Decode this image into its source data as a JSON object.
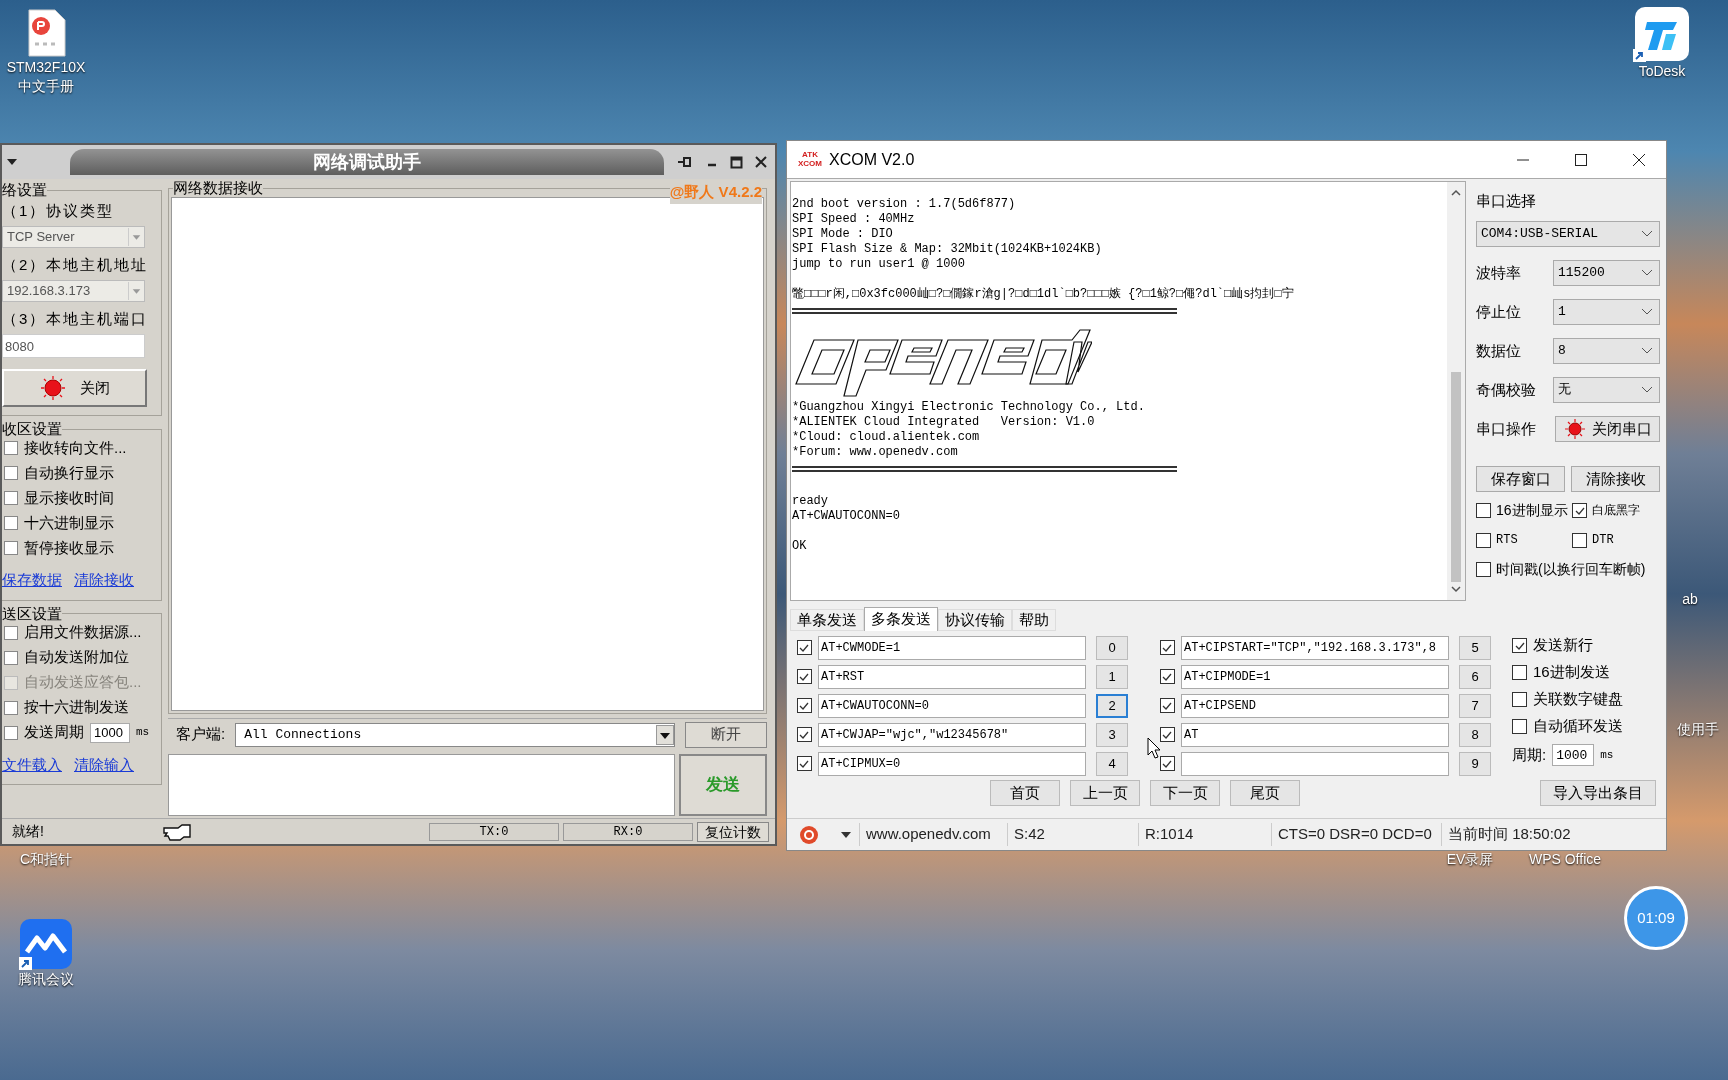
{
  "desktop_icons": [
    {
      "kind": "pdf",
      "label_lines": [
        "STM32F10X",
        "中文手册"
      ],
      "shortcut": false
    },
    {
      "kind": "todesk",
      "label_lines": [
        "ToDesk"
      ],
      "shortcut": true
    },
    {
      "kind": "label_only",
      "label_lines": [
        "C和指针"
      ],
      "shortcut": false
    },
    {
      "kind": "meeting",
      "label_lines": [
        "腾讯会议"
      ],
      "shortcut": true
    },
    {
      "kind": "label_only",
      "label_lines": [
        "EV录屏"
      ],
      "shortcut": false
    },
    {
      "kind": "label_only",
      "label_lines": [
        "WPS Office"
      ],
      "shortcut": false
    },
    {
      "kind": "label_only",
      "label_lines": [
        "ab"
      ],
      "shortcut": false
    },
    {
      "kind": "label_only",
      "label_lines": [
        "使用手"
      ],
      "shortcut": false
    }
  ],
  "timer": {
    "text": "01:09"
  },
  "net_assistant": {
    "title": "网络调试助手",
    "version": "@野人 V4.2.2",
    "net_settings": {
      "title": "络设置",
      "fields": [
        {
          "label": "（1）协议类型",
          "kind": "select",
          "value": "TCP Server",
          "disabled": true
        },
        {
          "label": "（2）本地主机地址",
          "kind": "select",
          "value": "192.168.3.173",
          "disabled": true
        },
        {
          "label": "（3）本地主机端口",
          "kind": "input",
          "value": "8080",
          "disabled": true
        }
      ],
      "button": "关闭"
    },
    "receive_settings": {
      "title": "收区设置",
      "options": [
        {
          "label": "接收转向文件...",
          "checked": false
        },
        {
          "label": "自动换行显示",
          "checked": false
        },
        {
          "label": "显示接收时间",
          "checked": false
        },
        {
          "label": "十六进制显示",
          "checked": false
        },
        {
          "label": "暂停接收显示",
          "checked": false
        }
      ],
      "links": [
        "保存数据",
        "清除接收"
      ]
    },
    "send_settings": {
      "title": "送区设置",
      "options": [
        {
          "kind": "check",
          "label": "启用文件数据源...",
          "checked": false,
          "disabled": false
        },
        {
          "kind": "check",
          "label": "自动发送附加位",
          "checked": false,
          "disabled": false
        },
        {
          "kind": "check",
          "label": "自动发送应答包...",
          "checked": false,
          "disabled": true
        },
        {
          "kind": "check",
          "label": "按十六进制发送",
          "checked": false,
          "disabled": false
        },
        {
          "kind": "period",
          "label": "发送周期",
          "checked": false,
          "disabled": false,
          "value": "1000",
          "unit": "ms"
        }
      ],
      "links": [
        "文件载入",
        "清除输入"
      ]
    },
    "receive_panel": {
      "title": "网络数据接收"
    },
    "client": {
      "label": "客户端:",
      "value": "All Connections",
      "button": "断开"
    },
    "send_button": "发送",
    "status_bar": {
      "status": "就绪!",
      "tx": "TX:0",
      "rx": "RX:0",
      "reset_button": "复位计数"
    }
  },
  "xcom": {
    "title": "XCOM V2.0",
    "logo_lines": [
      "ATK",
      "XCOM"
    ],
    "output": [
      {
        "kind": "text",
        "lines": [
          "2nd boot version : 1.7(5d6f877)",
          "SPI Speed : 40MHz",
          "SPI Mode : DIO",
          "SPI Flash Size & Map: 32Mbit(1024KB+1024KB)",
          "jump to run user1 @ 1000"
        ]
      },
      {
        "kind": "text",
        "lines": [
          "鼈□□□r闲,□0x3fc000屾□?□僩鎵r滄g|?□d□1dl`□b?□□□嫉 {?□1鲸?□僶?dl`□屾s抣刲□宁"
        ]
      },
      {
        "kind": "rule"
      },
      {
        "kind": "art"
      },
      {
        "kind": "text",
        "lines": [
          "*Guangzhou Xingyi Electronic Technology Co., Ltd.",
          "*ALIENTEK Cloud Integrated   Version: V1.0",
          "*Cloud: cloud.alientek.com",
          "*Forum: www.openedv.com"
        ]
      },
      {
        "kind": "rule"
      },
      {
        "kind": "text",
        "lines": [
          "ready",
          "AT+CWAUTOCONN=0"
        ]
      },
      {
        "kind": "text",
        "lines": [
          "OK"
        ]
      }
    ],
    "port_select": {
      "label": "串口选择",
      "value": "COM4:USB-SERIAL"
    },
    "settings": [
      {
        "label": "波特率",
        "value": "115200"
      },
      {
        "label": "停止位",
        "value": "1"
      },
      {
        "label": "数据位",
        "value": "8"
      },
      {
        "label": "奇偶校验",
        "value": "无"
      }
    ],
    "port_operation": {
      "label": "串口操作",
      "button": "关闭串口"
    },
    "buttons": [
      "保存窗口",
      "清除接收"
    ],
    "display_options": [
      {
        "label": "16进制显示",
        "checked": false
      },
      {
        "label": "白底黑字",
        "checked": true
      },
      {
        "label": "RTS",
        "checked": false
      },
      {
        "label": "DTR",
        "checked": false
      },
      {
        "label": "时间戳(以换行回车断帧)",
        "checked": false
      }
    ],
    "tabs": [
      {
        "label": "单条发送",
        "selected": false
      },
      {
        "label": "多条发送",
        "selected": true
      },
      {
        "label": "协议传输",
        "selected": false
      },
      {
        "label": "帮助",
        "selected": false
      }
    ],
    "entries": [
      {
        "checked": true,
        "text": "AT+CWMODE=1",
        "number": "0",
        "focused": false
      },
      {
        "checked": true,
        "text": "AT+RST",
        "number": "1",
        "focused": false
      },
      {
        "checked": true,
        "text": "AT+CWAUTOCONN=0",
        "number": "2",
        "focused": true
      },
      {
        "checked": true,
        "text": "AT+CWJAP=\"wjc\",\"w12345678\"",
        "number": "3",
        "focused": false
      },
      {
        "checked": true,
        "text": "AT+CIPMUX=0",
        "number": "4",
        "focused": false
      },
      {
        "checked": true,
        "text": "AT+CIPSTART=\"TCP\",\"192.168.3.173\",8",
        "number": "5",
        "focused": false
      },
      {
        "checked": true,
        "text": "AT+CIPMODE=1",
        "number": "6",
        "focused": false
      },
      {
        "checked": true,
        "text": "AT+CIPSEND",
        "number": "7",
        "focused": false
      },
      {
        "checked": true,
        "text": "AT",
        "number": "8",
        "focused": false
      },
      {
        "checked": true,
        "number": "9",
        "focused": false
      }
    ],
    "send_options": [
      {
        "label": "发送新行",
        "checked": true
      },
      {
        "label": "16进制发送",
        "checked": false
      },
      {
        "label": "关联数字键盘",
        "checked": false
      },
      {
        "label": "自动循环发送",
        "checked": false
      }
    ],
    "period": {
      "label": "周期:",
      "value": "1000",
      "unit": "ms"
    },
    "page_buttons": [
      "首页",
      "上一页",
      "下一页",
      "尾页"
    ],
    "import_export_button": "导入导出条目",
    "status_bar": [
      "www.openedv.com",
      "S:42",
      "R:1014",
      "CTS=0 DSR=0 DCD=0",
      "当前时间 18:50:02"
    ]
  }
}
